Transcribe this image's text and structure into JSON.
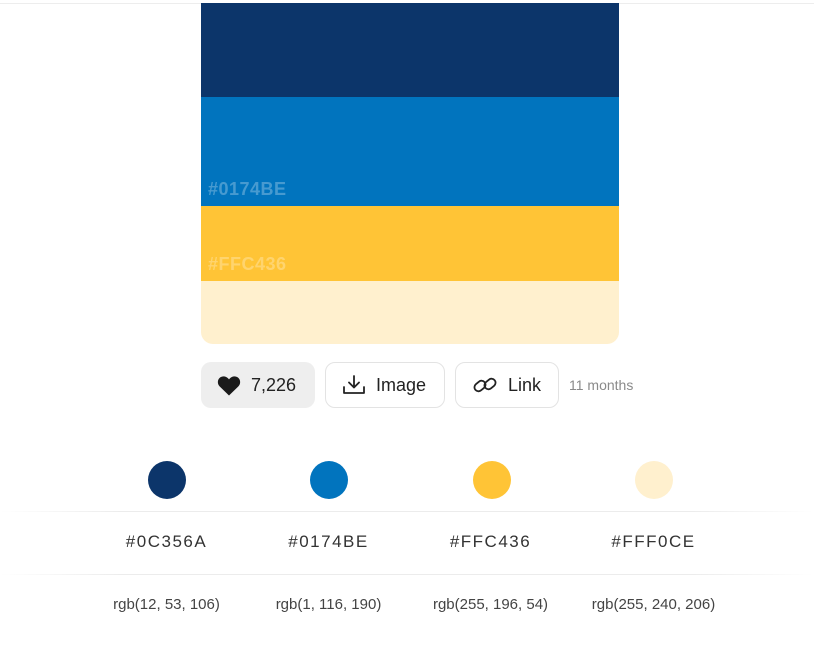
{
  "palette": {
    "swatches": [
      {
        "color": "#0C356A",
        "label": ""
      },
      {
        "color": "#0174BE",
        "label": "#0174BE"
      },
      {
        "color": "#FFC436",
        "label": "#FFC436"
      },
      {
        "color": "#FFF0CE",
        "label": ""
      }
    ]
  },
  "actions": {
    "like_count": "7,226",
    "image_label": "Image",
    "link_label": "Link",
    "age": "11 months"
  },
  "colors": [
    {
      "hex": "#0C356A",
      "rgb": "rgb(12, 53, 106)",
      "dot_color": "#0C356A"
    },
    {
      "hex": "#0174BE",
      "rgb": "rgb(1, 116, 190)",
      "dot_color": "#0174BE"
    },
    {
      "hex": "#FFC436",
      "rgb": "rgb(255, 196, 54)",
      "dot_color": "#FFC436"
    },
    {
      "hex": "#FFF0CE",
      "rgb": "rgb(255, 240, 206)",
      "dot_color": "#FFF0CE"
    }
  ]
}
